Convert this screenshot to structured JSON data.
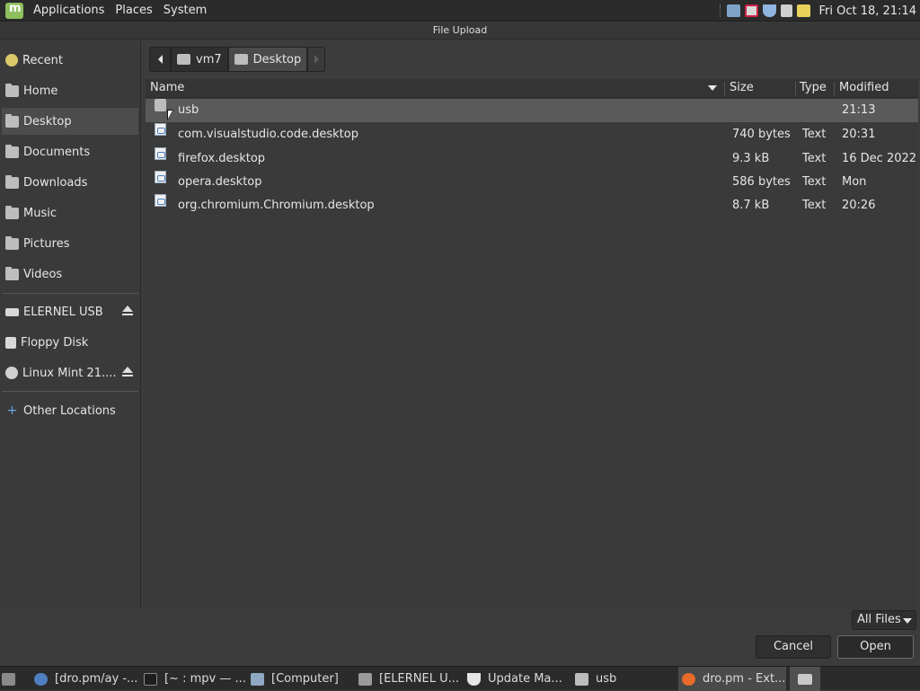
{
  "top_panel": {
    "menus": [
      "Applications",
      "Places",
      "System"
    ],
    "clock": "Fri Oct 18, 21:14",
    "tray_icons": [
      "network-icon",
      "update-icon",
      "shield-icon",
      "volume-icon",
      "notes-icon"
    ]
  },
  "window": {
    "title": "File Upload"
  },
  "sidebar": {
    "places": [
      {
        "label": "Recent",
        "icon": "recent-icon"
      },
      {
        "label": "Home",
        "icon": "home-folder-icon"
      },
      {
        "label": "Desktop",
        "icon": "desktop-folder-icon"
      },
      {
        "label": "Documents",
        "icon": "documents-folder-icon"
      },
      {
        "label": "Downloads",
        "icon": "downloads-folder-icon"
      },
      {
        "label": "Music",
        "icon": "music-folder-icon"
      },
      {
        "label": "Pictures",
        "icon": "pictures-folder-icon"
      },
      {
        "label": "Videos",
        "icon": "videos-folder-icon"
      }
    ],
    "devices": [
      {
        "label": "ELERNEL USB",
        "icon": "drive-icon"
      },
      {
        "label": "Floppy Disk",
        "icon": "floppy-icon"
      },
      {
        "label": "Linux Mint 21....",
        "icon": "disc-icon"
      }
    ],
    "other": {
      "label": "Other Locations",
      "icon": "plus-icon"
    },
    "active": "Desktop"
  },
  "pathbar": {
    "crumbs": [
      "vm7",
      "Desktop"
    ],
    "current": "Desktop"
  },
  "filelist": {
    "columns": {
      "name": "Name",
      "size": "Size",
      "type": "Type",
      "modified": "Modified"
    },
    "rows": [
      {
        "name": "usb",
        "size": "",
        "type": "",
        "modified": "21:13",
        "kind": "folder",
        "selected": true
      },
      {
        "name": "com.visualstudio.code.desktop",
        "size": "740 bytes",
        "type": "Text",
        "modified": "20:31",
        "kind": "doc"
      },
      {
        "name": "firefox.desktop",
        "size": "9.3 kB",
        "type": "Text",
        "modified": "16 Dec 2022",
        "kind": "doc"
      },
      {
        "name": "opera.desktop",
        "size": "586 bytes",
        "type": "Text",
        "modified": "Mon",
        "kind": "doc"
      },
      {
        "name": "org.chromium.Chromium.desktop",
        "size": "8.7 kB",
        "type": "Text",
        "modified": "20:26",
        "kind": "doc"
      }
    ]
  },
  "filter": {
    "value": "All Files"
  },
  "buttons": {
    "cancel": "Cancel",
    "open": "Open"
  },
  "taskbar": {
    "items": [
      {
        "label": "[dro.pm/ay -...",
        "icon": "browser-icon"
      },
      {
        "label": "[~ : mpv — ...",
        "icon": "terminal-icon"
      },
      {
        "label": "[Computer]",
        "icon": "computer-icon"
      },
      {
        "label": "[ELERNEL U...",
        "icon": "drive-window-icon"
      },
      {
        "label": "Update Ma...",
        "icon": "shield-icon"
      },
      {
        "label": "usb",
        "icon": "folder-icon"
      },
      {
        "label": "dro.pm - Ext...",
        "icon": "firefox-icon",
        "active": true
      }
    ]
  }
}
